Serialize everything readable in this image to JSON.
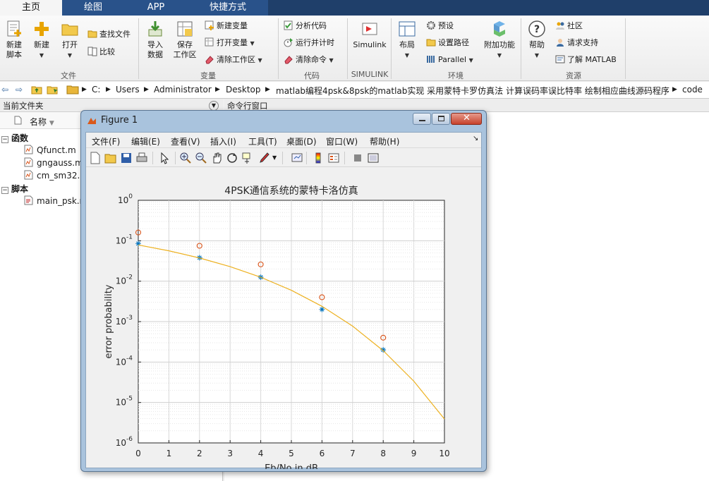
{
  "tabs": [
    "主页",
    "绘图",
    "APP",
    "快捷方式"
  ],
  "ribbon": {
    "file": {
      "new_script": "新建\n脚本",
      "new": "新建",
      "open": "打开",
      "find_files": "查找文件",
      "compare": "比较",
      "group": "文件"
    },
    "variable": {
      "import": "导入\n数据",
      "save_ws": "保存\n工作区",
      "new_var": "新建变量",
      "open_var": "打开变量",
      "clear_ws": "清除工作区",
      "group": "变量"
    },
    "code": {
      "analyze": "分析代码",
      "run_time": "运行并计时",
      "clear_cmd": "清除命令",
      "group": "代码"
    },
    "simulink": {
      "label": "Simulink",
      "group": "SIMULINK"
    },
    "env": {
      "layout": "布局",
      "prefs": "预设",
      "set_path": "设置路径",
      "parallel": "Parallel",
      "addons": "附加功能",
      "group": "环境"
    },
    "resources": {
      "help": "帮助",
      "community": "社区",
      "support": "请求支持",
      "learn": "了解 MATLAB",
      "group": "资源"
    }
  },
  "address": [
    "C:",
    "Users",
    "Administrator",
    "Desktop",
    "matlab编程4psk&8psk的matlab实现 采用蒙特卡罗仿真法 计算误码率误比特率 绘制相应曲线源码程序",
    "code"
  ],
  "current_folder": {
    "title": "当前文件夹",
    "col_name": "名称",
    "sections": [
      {
        "label": "函数",
        "files": [
          "Qfunct.m",
          "gngauss.m",
          "cm_sm32.m"
        ]
      },
      {
        "label": "脚本",
        "files": [
          "main_psk.m"
        ]
      }
    ]
  },
  "command_window": {
    "title": "命令行窗口"
  },
  "figure": {
    "title": "Figure 1",
    "menu": [
      "文件(F)",
      "编辑(E)",
      "查看(V)",
      "插入(I)",
      "工具(T)",
      "桌面(D)",
      "窗口(W)",
      "帮助(H)"
    ]
  },
  "chart_data": {
    "type": "scatter",
    "title": "4PSK通信系统的蒙特卡洛仿真",
    "xlabel": "Eb/No in dB",
    "ylabel": "error probability",
    "xlim": [
      0,
      10
    ],
    "ylim": [
      1e-06,
      1
    ],
    "y_scale": "log",
    "grid": true,
    "x_ticks": [
      "0",
      "1",
      "2",
      "3",
      "4",
      "5",
      "6",
      "7",
      "8",
      "9",
      "10"
    ],
    "y_tick_exponents": [
      "0",
      "-1",
      "-2",
      "-3",
      "-4",
      "-5",
      "-6"
    ],
    "series": [
      {
        "marker": "circle",
        "color": "#d95319",
        "x": [
          0,
          2,
          4,
          6,
          8
        ],
        "y": [
          0.16,
          0.075,
          0.026,
          0.004,
          0.0004
        ]
      },
      {
        "marker": "star",
        "color": "#0072bd",
        "x": [
          0,
          2,
          4,
          6,
          8
        ],
        "y": [
          0.085,
          0.038,
          0.0125,
          0.002,
          0.0002
        ]
      },
      {
        "marker": "line",
        "color": "#edb120",
        "x": [
          0,
          1,
          2,
          3,
          4,
          5,
          6,
          7,
          8,
          9,
          10
        ],
        "y": [
          0.0786,
          0.0563,
          0.0375,
          0.0229,
          0.0125,
          0.00595,
          0.00239,
          0.000773,
          0.000191,
          3.36e-05,
          3.9e-06
        ]
      }
    ]
  }
}
